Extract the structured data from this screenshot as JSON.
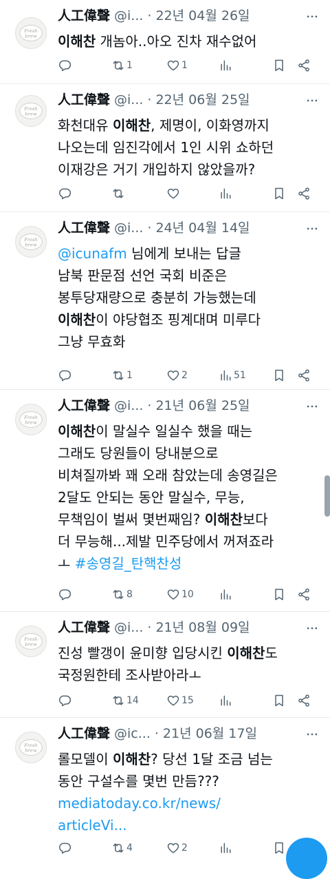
{
  "tweets": [
    {
      "name": "人工偉聲",
      "handle": "@i...",
      "date": "22년 04월 26일",
      "lines": [
        [
          {
            "t": "이해찬",
            "b": true
          },
          {
            "t": " 개놈아..아오 진차 재수없어"
          }
        ]
      ],
      "reply": "",
      "retweet": "1",
      "like": "1",
      "views": ""
    },
    {
      "name": "人工偉聲",
      "handle": "@i...",
      "date": "22년 06월 25일",
      "lines": [
        [
          {
            "t": "화천대유 "
          },
          {
            "t": "이해찬",
            "b": true
          },
          {
            "t": ", 제명이, 이화영까지"
          }
        ],
        [
          {
            "t": "나오는데 임진각에서 1인 시위 쇼하던"
          }
        ],
        [
          {
            "t": "이재강은 거기 개입하지 않았을까?"
          }
        ]
      ],
      "reply": "",
      "retweet": "",
      "like": "",
      "views": ""
    },
    {
      "name": "人工偉聲",
      "handle": "@i...",
      "date": "24년 04월 14일",
      "replying_to_handle": "@icunafm",
      "replying_to_text": " 님에게 보내는 답글",
      "lines": [
        [
          {
            "t": "남북 판문점 선언 국회 비준은"
          }
        ],
        [
          {
            "t": "봉투당재량으로 충분히 가능했는데"
          }
        ],
        [
          {
            "t": "이해찬",
            "b": true
          },
          {
            "t": "이 야당협조 핑계대며 미루다"
          }
        ],
        [
          {
            "t": "그냥 무효화"
          }
        ]
      ],
      "reply": "",
      "retweet": "1",
      "like": "2",
      "views": "51"
    },
    {
      "name": "人工偉聲",
      "handle": "@i...",
      "date": "21년 06월 25일",
      "lines": [
        [
          {
            "t": "이해찬",
            "b": true
          },
          {
            "t": "이 말실수 일실수 했을 때는"
          }
        ],
        [
          {
            "t": "그래도 당원들이 당내분으로"
          }
        ],
        [
          {
            "t": "비쳐질까봐 꽤 오래 참았는데 송영길은"
          }
        ],
        [
          {
            "t": "2달도 안되는 동안 말실수, 무능,"
          }
        ],
        [
          {
            "t": "무책임이 벌써 몇번째임? "
          },
          {
            "t": "이해찬",
            "b": true
          },
          {
            "t": "보다"
          }
        ],
        [
          {
            "t": "더 무능해...제발 민주당에서 꺼져죠라"
          }
        ],
        [
          {
            "t": "ㅗ "
          },
          {
            "t": "#송영길_탄핵찬성",
            "link": true
          }
        ]
      ],
      "reply": "",
      "retweet": "8",
      "like": "10",
      "views": ""
    },
    {
      "name": "人工偉聲",
      "handle": "@i...",
      "date": "21년 08월 09일",
      "lines": [
        [
          {
            "t": "진성 빨갱이 윤미향 입당시킨 "
          },
          {
            "t": "이해찬",
            "b": true
          },
          {
            "t": "도"
          }
        ],
        [
          {
            "t": "국정원한테 조사받아라ㅗ"
          }
        ]
      ],
      "reply": "",
      "retweet": "14",
      "like": "15",
      "views": ""
    },
    {
      "name": "人工偉聲",
      "handle": "@ic...",
      "date": "21년 06월 17일",
      "lines": [
        [
          {
            "t": "롤모델이 "
          },
          {
            "t": "이해찬",
            "b": true
          },
          {
            "t": "? 당선 1달 조금 넘는"
          }
        ],
        [
          {
            "t": "동안 구설수를 몇번 만듬???"
          }
        ],
        [
          {
            "t": "mediatoday.co.kr/news/",
            "link": true
          }
        ],
        [
          {
            "t": "articleVi...",
            "link": true
          }
        ]
      ],
      "reply": "",
      "retweet": "4",
      "like": "2",
      "views": ""
    }
  ],
  "avatar_text": "Fresh brew",
  "colors": {
    "accent": "#1d9bf0",
    "muted": "#536471",
    "text": "#0f1419",
    "divider": "#e6ecf0"
  }
}
